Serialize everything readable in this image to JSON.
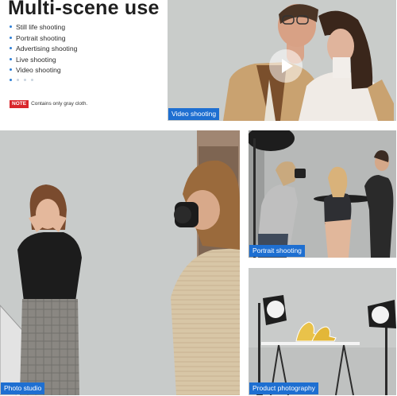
{
  "header": {
    "title": "Multi-scene use",
    "features": [
      "Still life shooting",
      "Portrait shooting",
      "Advertising shooting",
      "Live shooting",
      "Video shooting"
    ],
    "pager": {
      "count": 4,
      "active": 0
    }
  },
  "note": {
    "tag": "NOTE",
    "text": "Contains only gray cloth."
  },
  "panels": {
    "video": {
      "caption": "Video shooting"
    },
    "photo_studio": {
      "caption": "Photo studio"
    },
    "portrait": {
      "caption": "Portrait shooting"
    },
    "product": {
      "caption": "Product photography"
    }
  },
  "colors": {
    "accent": "#1e6fd1",
    "note": "#d9262c",
    "backdrop": "#c9cbc8"
  }
}
